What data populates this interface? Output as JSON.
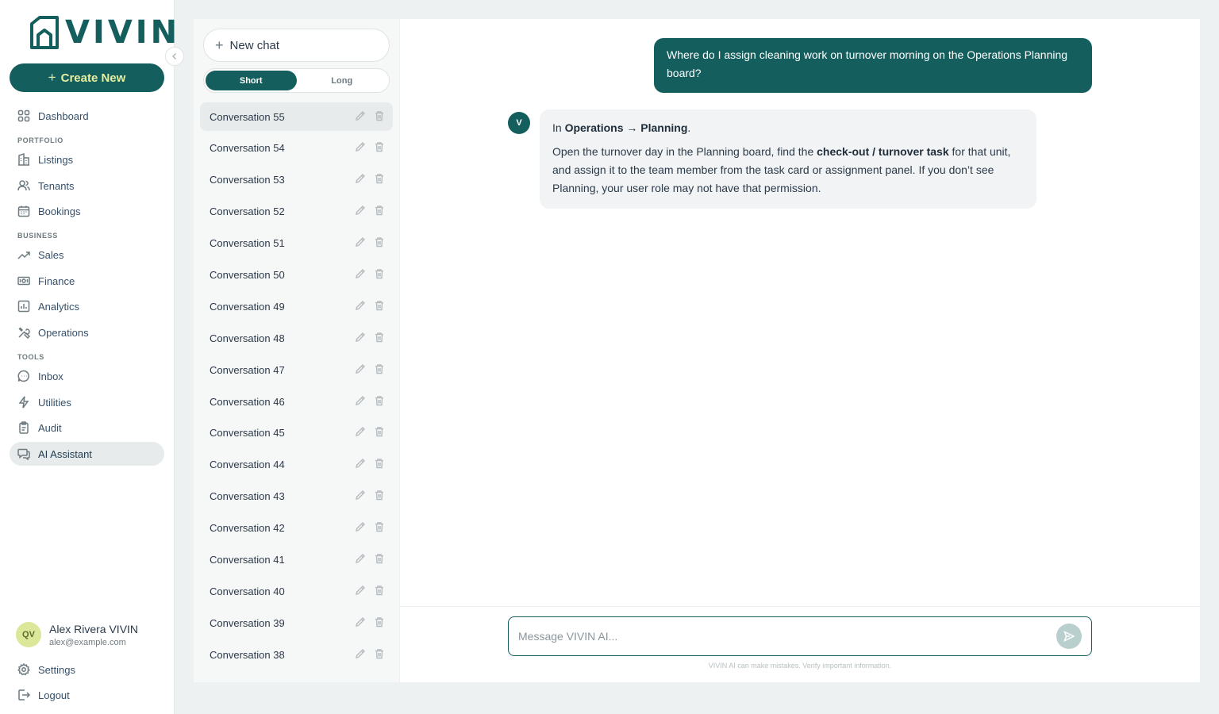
{
  "brand": {
    "name": "VIVIN",
    "color": "#155e5e",
    "accent": "#e7f0a0"
  },
  "sidebar": {
    "create_label": "Create New",
    "collapse_icon": "chevron-left-icon",
    "dashboard": "Dashboard",
    "sections": {
      "portfolio": "PORTFOLIO",
      "business": "BUSINESS",
      "tools": "TOOLS"
    },
    "items": {
      "listings": "Listings",
      "tenants": "Tenants",
      "bookings": "Bookings",
      "sales": "Sales",
      "finance": "Finance",
      "analytics": "Analytics",
      "operations": "Operations",
      "inbox": "Inbox",
      "utilities": "Utilities",
      "audit": "Audit",
      "ai_assistant": "AI Assistant"
    },
    "active_item": "AI Assistant",
    "user": {
      "initials": "QV",
      "name": "Alex Rivera VIVIN",
      "email": "alex@example.com"
    },
    "settings": "Settings",
    "logout": "Logout"
  },
  "conversations": {
    "new_chat_label": "New chat",
    "toggle": {
      "short": "Short",
      "long": "Long",
      "selected": "Short"
    },
    "items": [
      "Conversation 55",
      "Conversation 54",
      "Conversation 53",
      "Conversation 52",
      "Conversation 51",
      "Conversation 50",
      "Conversation 49",
      "Conversation 48",
      "Conversation 47",
      "Conversation 46",
      "Conversation 45",
      "Conversation 44",
      "Conversation 43",
      "Conversation 42",
      "Conversation 41",
      "Conversation 40",
      "Conversation 39",
      "Conversation 38"
    ],
    "active": "Conversation 55"
  },
  "chat": {
    "user_message": "Where do I assign cleaning work on turnover morning on the Operations Planning board?",
    "bot_avatar": "V",
    "bot_message": {
      "line1_prefix": "In ",
      "line1_bold": "Operations → Planning",
      "line1_suffix": ".",
      "line2_prefix": "Open the turnover day in the Planning board, find the ",
      "line2_bold": "check-out / turnover task",
      "line2_suffix": " for that unit, and assign it to the team member from the task card or assignment panel. If you don’t see Planning, your user role may not have that permission."
    },
    "composer_placeholder": "Message VIVIN AI...",
    "disclaimer": "VIVIN AI can make mistakes. Verify important information."
  }
}
